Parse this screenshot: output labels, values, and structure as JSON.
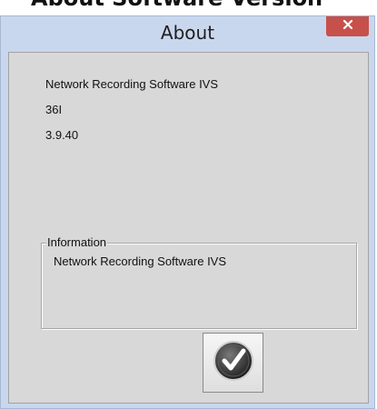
{
  "background_heading": "About Software Version",
  "window": {
    "title": "About",
    "close_icon": "close-x-icon",
    "close_color": "#c7504a"
  },
  "about": {
    "product_name": "Network Recording Software IVS",
    "model": "36I",
    "version": "3.9.40"
  },
  "information": {
    "legend": "Information",
    "text": "Network Recording Software IVS"
  },
  "ok_button": {
    "icon": "checkmark-icon"
  }
}
